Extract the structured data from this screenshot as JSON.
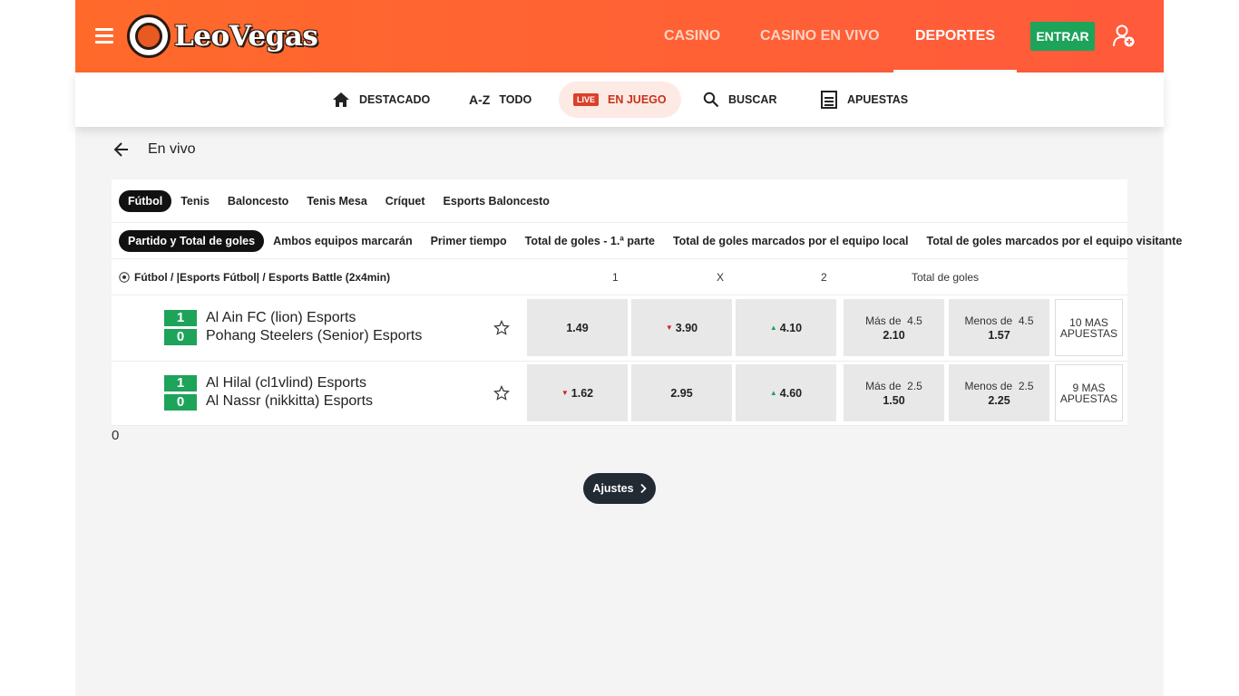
{
  "header": {
    "logo_text": "LeoVegas",
    "nav": [
      {
        "label": "CASINO",
        "active": false
      },
      {
        "label": "CASINO EN VIVO",
        "active": false
      },
      {
        "label": "DEPORTES",
        "active": true
      }
    ],
    "login_label": "ENTRAR",
    "brand_color": "#ff5a3c",
    "login_color": "#1ea35b"
  },
  "subnav": {
    "items": [
      {
        "label": "DESTACADO",
        "icon": "home-icon"
      },
      {
        "label": "TODO",
        "icon": "az-icon",
        "icon_text": "A-Z"
      },
      {
        "label": "EN JUEGO",
        "icon": "live-icon",
        "badge": "LIVE",
        "active": true
      },
      {
        "label": "BUSCAR",
        "icon": "search-icon"
      },
      {
        "label": "APUESTAS",
        "icon": "betslip-icon"
      }
    ]
  },
  "page": {
    "title": "En vivo"
  },
  "sports": [
    "Fútbol",
    "Tenis",
    "Baloncesto",
    "Tenis Mesa",
    "Críquet",
    "Esports Baloncesto"
  ],
  "markets": [
    "Partido y Total de goles",
    "Ambos equipos marcarán",
    "Primer tiempo",
    "Total de goles - 1.ª parte",
    "Total de goles marcados por el equipo local",
    "Total de goles marcados por el equipo visitante"
  ],
  "table": {
    "breadcrumb": "Fútbol / |Esports Fútbol| / Esports Battle (2x4min)",
    "col_1": "1",
    "col_x": "X",
    "col_2": "2",
    "col_total": "Total de goles"
  },
  "matches": [
    {
      "home_score": "1",
      "away_score": "0",
      "home": "Al Ain FC (lion) Esports",
      "away": "Pohang Steelers (Senior) Esports",
      "odd_1": "1.49",
      "odd_1_trend": "",
      "odd_x": "3.90",
      "odd_x_trend": "down",
      "odd_2": "4.10",
      "odd_2_trend": "up",
      "over_label": "Más de",
      "over_line": "4.5",
      "over_odd": "2.10",
      "under_label": "Menos de",
      "under_line": "4.5",
      "under_odd": "1.57",
      "more_line1": "10 MAS",
      "more_line2": "APUESTAS"
    },
    {
      "home_score": "1",
      "away_score": "0",
      "home": "Al Hilal (cl1vlind) Esports",
      "away": "Al Nassr (nikkitta) Esports",
      "odd_1": "1.62",
      "odd_1_trend": "down",
      "odd_x": "2.95",
      "odd_x_trend": "",
      "odd_2": "4.60",
      "odd_2_trend": "up",
      "over_label": "Más de",
      "over_line": "2.5",
      "over_odd": "1.50",
      "under_label": "Menos de",
      "under_line": "2.5",
      "under_odd": "2.25",
      "more_line1": "9 MAS",
      "more_line2": "APUESTAS"
    }
  ],
  "stray_text": "0",
  "settings_label": "Ajustes"
}
